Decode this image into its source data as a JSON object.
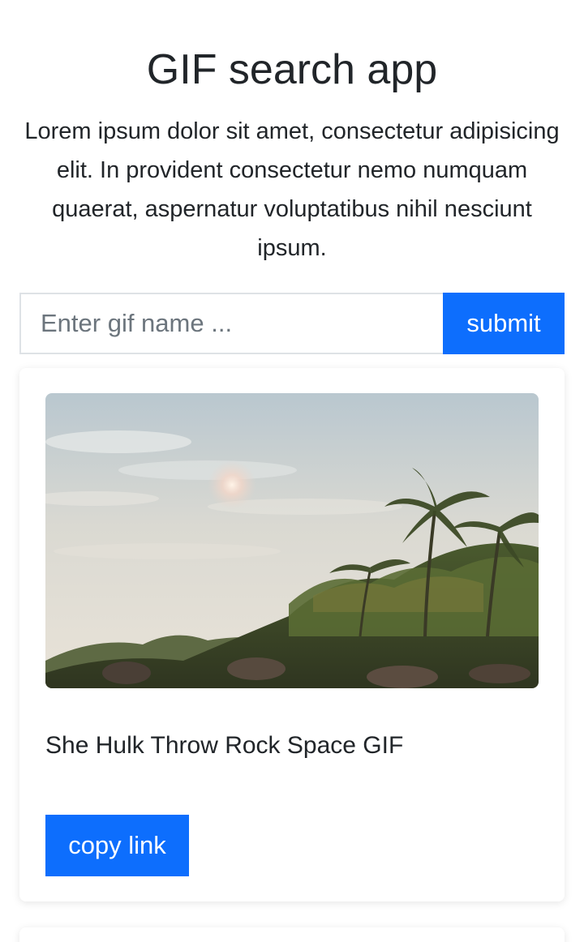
{
  "header": {
    "title": "GIF search app",
    "lead": "Lorem ipsum dolor sit amet, consectetur adipisicing elit. In provident consectetur nemo numquam quaerat, aspernatur voluptatibus nihil nesciunt ipsum."
  },
  "search": {
    "placeholder": "Enter gif name ...",
    "value": "",
    "submit_label": "submit"
  },
  "results": [
    {
      "title": "She Hulk Throw Rock Space GIF",
      "copy_label": "copy link"
    }
  ],
  "colors": {
    "primary": "#0d6efd",
    "text": "#212529",
    "border": "#dee2e6"
  }
}
